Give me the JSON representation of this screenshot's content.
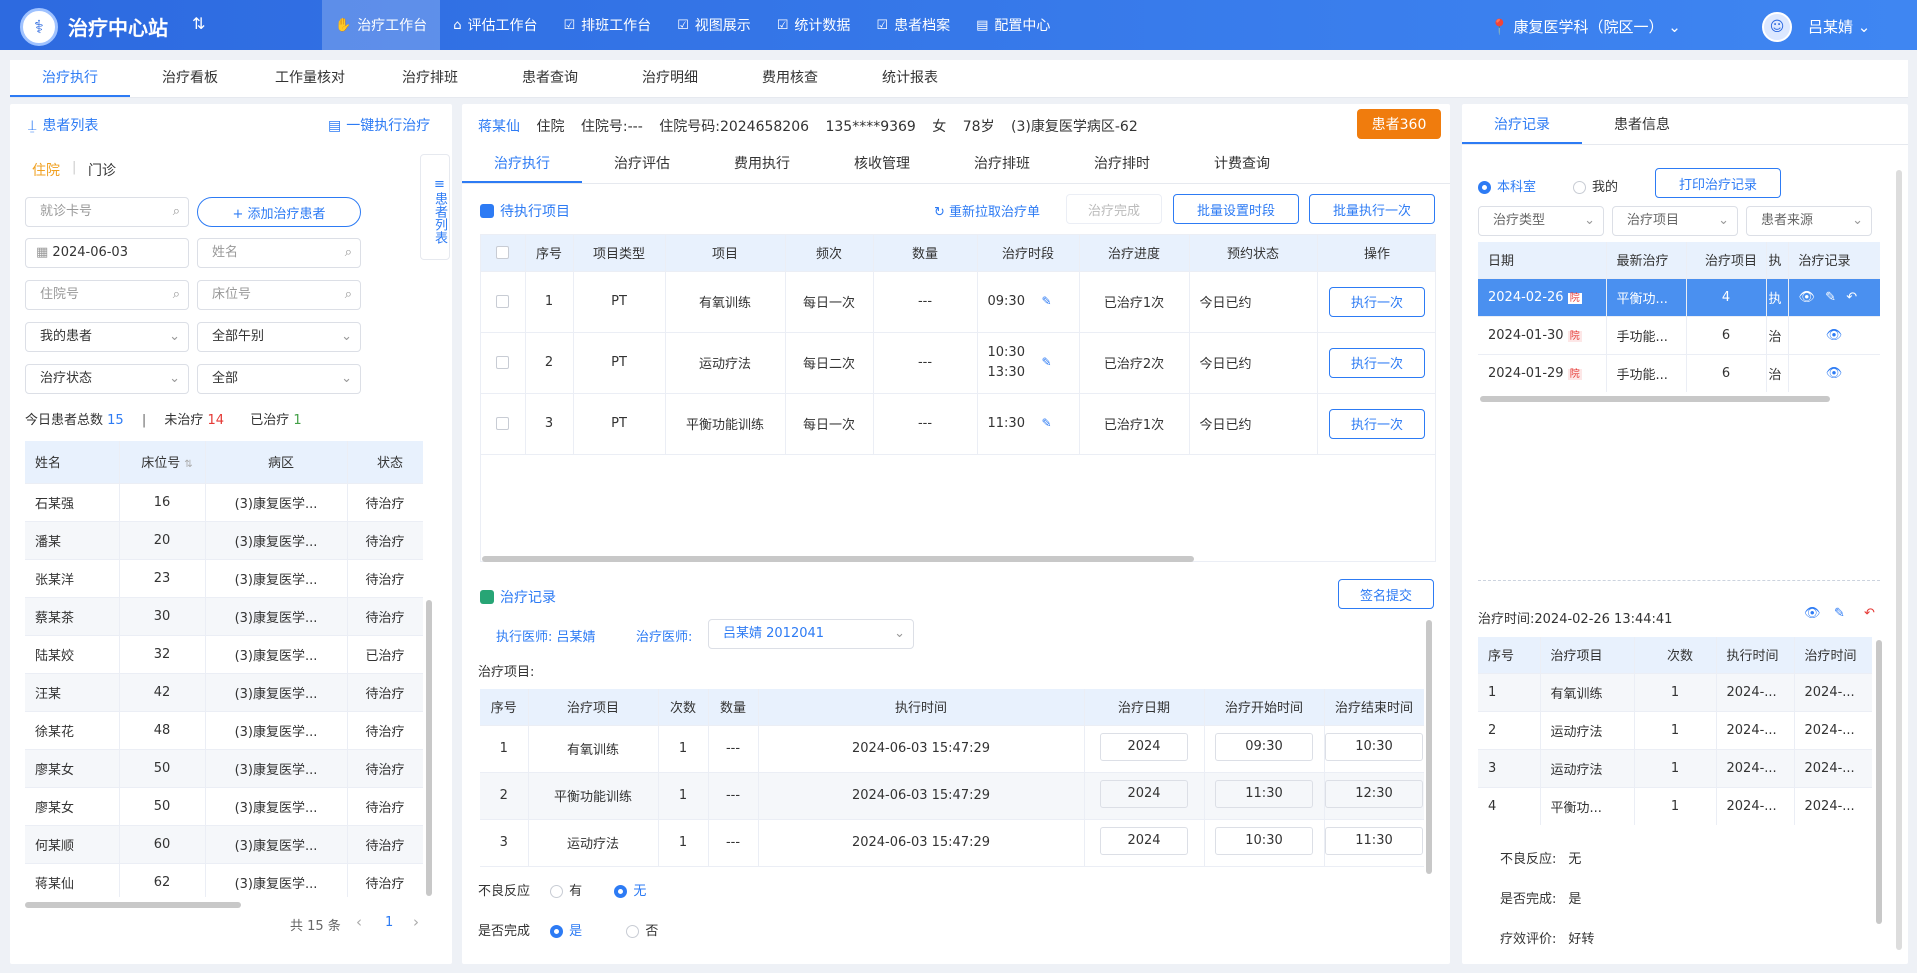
{
  "app": {
    "title": "治疗中心站",
    "switch_icon": "⇅",
    "nav": [
      {
        "label": "治疗工作台",
        "icon": "hand-icon",
        "glyph": "✋",
        "active": true
      },
      {
        "label": "评估工作台",
        "icon": "home-icon",
        "glyph": "⌂"
      },
      {
        "label": "排班工作台",
        "icon": "schedule-icon",
        "glyph": "☑"
      },
      {
        "label": "视图展示",
        "icon": "view-icon",
        "glyph": "☑"
      },
      {
        "label": "统计数据",
        "icon": "stats-icon",
        "glyph": "☑"
      },
      {
        "label": "患者档案",
        "icon": "archive-icon",
        "glyph": "☑"
      },
      {
        "label": "配置中心",
        "icon": "config-icon",
        "glyph": "▤"
      }
    ],
    "department": "康复医学科（院区一）",
    "department_icon": "📍",
    "user": "吕某婧",
    "chevron": "⌄"
  },
  "subtabs": [
    "治疗执行",
    "治疗看板",
    "工作量核对",
    "治疗排班",
    "患者查询",
    "治疗明细",
    "费用核查",
    "统计报表"
  ],
  "left": {
    "title": "患者列表",
    "one_click": "一键执行治疗",
    "type_tabs": [
      "住院",
      "门诊"
    ],
    "sep": "|",
    "card_placeholder": "就诊卡号",
    "add_patient": "+ 添加治疗患者",
    "date": "2024-06-03",
    "name_placeholder": "姓名",
    "inpatient_no_placeholder": "住院号",
    "bed_placeholder": "床位号",
    "my_patients": "我的患者",
    "all_shift": "全部午别",
    "treat_status": "治疗状态",
    "all": "全部",
    "side_label": "患者列表",
    "stats": {
      "total_label": "今日患者总数",
      "total": "15",
      "sep": "|",
      "untreated_label": "未治疗",
      "untreated": "14",
      "treated_label": "已治疗",
      "treated": "1"
    },
    "columns": [
      "姓名",
      "床位号",
      "病区",
      "状态"
    ],
    "rows": [
      [
        "石某强",
        "16",
        "(3)康复医学...",
        "待治疗"
      ],
      [
        "潘某",
        "20",
        "(3)康复医学...",
        "待治疗"
      ],
      [
        "张某洋",
        "23",
        "(3)康复医学...",
        "待治疗"
      ],
      [
        "蔡某茶",
        "30",
        "(3)康复医学...",
        "待治疗"
      ],
      [
        "陆某姣",
        "32",
        "(3)康复医学...",
        "已治疗"
      ],
      [
        "汪某",
        "42",
        "(3)康复医学...",
        "待治疗"
      ],
      [
        "徐某花",
        "48",
        "(3)康复医学...",
        "待治疗"
      ],
      [
        "廖某女",
        "50",
        "(3)康复医学...",
        "待治疗"
      ],
      [
        "廖某女",
        "50",
        "(3)康复医学...",
        "待治疗"
      ],
      [
        "何某顺",
        "60",
        "(3)康复医学...",
        "待治疗"
      ],
      [
        "蒋某仙",
        "62",
        "(3)康复医学...",
        "待治疗"
      ]
    ],
    "pager": {
      "total": "共 15 条",
      "prev": "‹",
      "page": "1",
      "next": "›"
    }
  },
  "patient": {
    "name": "蒋某仙",
    "type": "住院",
    "inpatient_no": "住院号:---",
    "hospital_code": "住院号码:2024658206",
    "phone": "135****9369",
    "sex": "女",
    "age": "78岁",
    "ward": "(3)康复医学病区-62",
    "btn360": "患者360"
  },
  "center_tabs": [
    "治疗执行",
    "治疗评估",
    "费用执行",
    "核收管理",
    "治疗排班",
    "治疗排时",
    "计费查询"
  ],
  "pending": {
    "title": "待执行项目",
    "refresh": "重新拉取治疗单",
    "done": "治疗完成",
    "batch_time": "批量设置时段",
    "batch_exec": "批量执行一次",
    "columns": [
      "序号",
      "项目类型",
      "项目",
      "频次",
      "数量",
      "治疗时段",
      "治疗进度",
      "预约状态",
      "操作"
    ],
    "rows": [
      {
        "no": "1",
        "type": "PT",
        "item": "有氧训练",
        "freq": "每日一次",
        "qty": "---",
        "time1": "09:30",
        "time2": "",
        "progress": "已治疗1次",
        "status": "今日已约",
        "action": "执行一次"
      },
      {
        "no": "2",
        "type": "PT",
        "item": "运动疗法",
        "freq": "每日二次",
        "qty": "---",
        "time1": "10:30",
        "time2": "13:30",
        "progress": "已治疗2次",
        "status": "今日已约",
        "action": "执行一次"
      },
      {
        "no": "3",
        "type": "PT",
        "item": "平衡功能训练",
        "freq": "每日一次",
        "qty": "---",
        "time1": "11:30",
        "time2": "",
        "progress": "已治疗1次",
        "status": "今日已约",
        "action": "执行一次"
      }
    ]
  },
  "record": {
    "title": "治疗记录",
    "sign": "签名提交",
    "exec_doctor_label": "执行医师:",
    "exec_doctor": "吕某婧",
    "doctor_label": "治疗医师:",
    "doctor_value": "吕某婧   2012041",
    "items_label": "治疗项目:",
    "columns": [
      "序号",
      "治疗项目",
      "次数",
      "数量",
      "执行时间",
      "治疗日期",
      "治疗开始时间",
      "治疗结束时间"
    ],
    "rows": [
      [
        "1",
        "有氧训练",
        "1",
        "---",
        "2024-06-03   15:47:29",
        "2024",
        "09:30",
        "10:30"
      ],
      [
        "2",
        "平衡功能训练",
        "1",
        "---",
        "2024-06-03   15:47:29",
        "2024",
        "11:30",
        "12:30"
      ],
      [
        "3",
        "运动疗法",
        "1",
        "---",
        "2024-06-03   15:47:29",
        "2024",
        "10:30",
        "11:30"
      ]
    ],
    "adverse_label": "不良反应",
    "yes": "有",
    "no": "无",
    "complete_label": "是否完成",
    "yes2": "是",
    "no2": "否"
  },
  "right": {
    "tabs": [
      "治疗记录",
      "患者信息"
    ],
    "radio1": "本科室",
    "radio2": "我的",
    "print": "打印治疗记录",
    "filter1": "治疗类型",
    "filter2": "治疗项目",
    "filter3": "患者来源",
    "columns": [
      "日期",
      "最新治疗",
      "治疗项目",
      "执",
      "治疗记录"
    ],
    "badge": "院",
    "rows": [
      [
        "2024-02-26",
        "平衡功...",
        "4",
        "执"
      ],
      [
        "2024-01-30",
        "手功能...",
        "6",
        "治"
      ],
      [
        "2024-01-29",
        "手功能...",
        "6",
        "治"
      ]
    ],
    "time_label": "治疗时间:2024-02-26 13:44:41",
    "detail_columns": [
      "序号",
      "治疗项目",
      "次数",
      "执行时间",
      "治疗时间"
    ],
    "detail_rows": [
      [
        "1",
        "有氧训练",
        "1",
        "2024-...",
        "2024-..."
      ],
      [
        "2",
        "运动疗法",
        "1",
        "2024-...",
        "2024-..."
      ],
      [
        "3",
        "运动疗法",
        "1",
        "2024-...",
        "2024-..."
      ],
      [
        "4",
        "平衡功...",
        "1",
        "2024-...",
        "2024-..."
      ]
    ],
    "adverse_label": "不良反应:",
    "adverse": "无",
    "complete_label": "是否完成:",
    "complete": "是",
    "effect_label": "疗效评价:",
    "effect": "好转"
  }
}
